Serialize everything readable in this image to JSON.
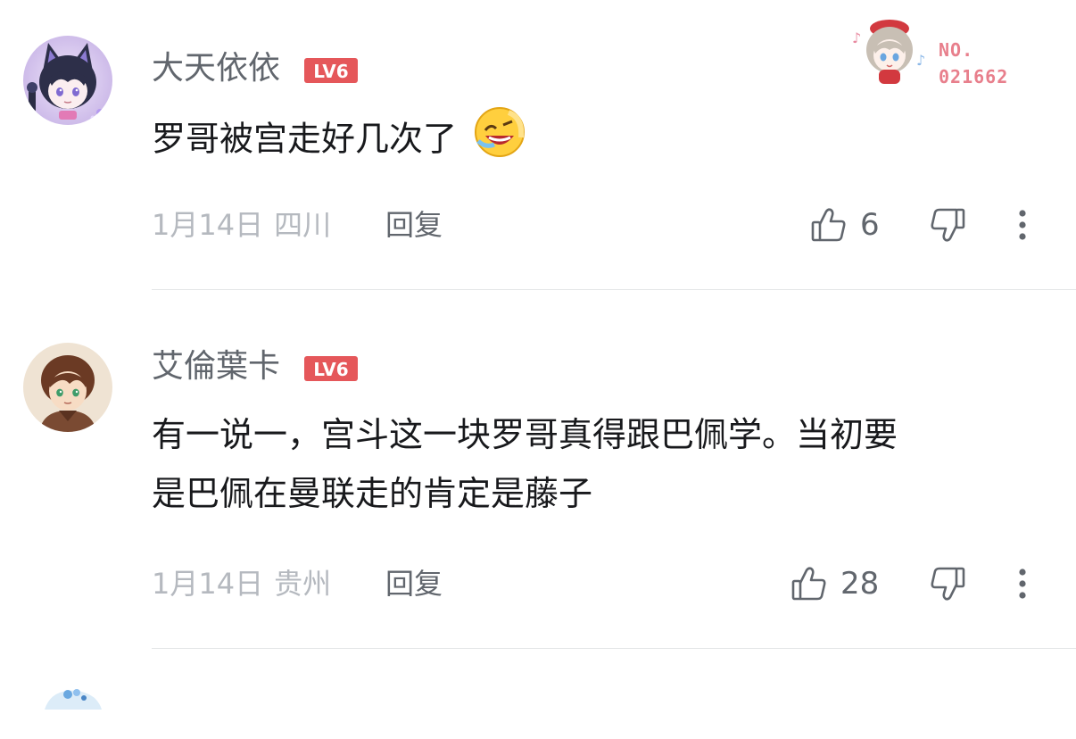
{
  "comments": [
    {
      "username": "大天依依",
      "level": "LV6",
      "text": "罗哥被宫走好几次了",
      "emoji": "grinning-squinting-face",
      "date": "1月14日",
      "location": "四川",
      "reply_label": "回复",
      "like_count": "6",
      "fan_badge": {
        "no_label": "NO.",
        "number": "021662"
      }
    },
    {
      "username": "艾倫葉卡",
      "level": "LV6",
      "text_lines": [
        "有一说一，宫斗这一块罗哥真得跟巴佩学。当初要",
        "是巴佩在曼联走的肯定是藤子"
      ],
      "date": "1月14日",
      "location": "贵州",
      "reply_label": "回复",
      "like_count": "28"
    }
  ],
  "colors": {
    "username": "#61666d",
    "meta": "#b5b9bf",
    "level_badge": "#e5575a",
    "fan_badge_text": "#e87f8c",
    "divider": "#e3e5e7"
  },
  "icons": [
    "thumb-up-icon",
    "thumb-down-icon",
    "more-vertical-icon"
  ]
}
